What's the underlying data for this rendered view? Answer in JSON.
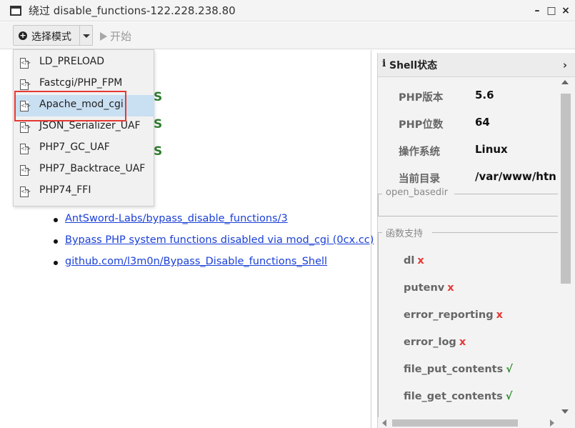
{
  "window": {
    "title": "绕过 disable_functions-122.228.238.80",
    "minimize": "–",
    "maximize": "□",
    "close": "×"
  },
  "toolbar": {
    "mode_button": "选择模式",
    "start_button": "开始"
  },
  "mode_menu": {
    "items": [
      {
        "label": "LD_PRELOAD"
      },
      {
        "label": "Fastcgi/PHP_FPM"
      },
      {
        "label": "Apache_mod_cgi"
      },
      {
        "label": "JSON_Serializer_UAF"
      },
      {
        "label": "PHP7_GC_UAF"
      },
      {
        "label": "PHP7_Backtrace_UAF"
      },
      {
        "label": "PHP74_FFI"
      }
    ],
    "selected": "Apache_mod_cgi",
    "highlight_color": "#e53935"
  },
  "main": {
    "partial_labels": [
      "S",
      "S",
      "S"
    ],
    "links": [
      "AntSword-Labs/bypass_disable_functions/3",
      "Bypass PHP system functions disabled via mod_cgi (0cx.cc)",
      "github.com/l3m0n/Bypass_Disable_functions_Shell"
    ]
  },
  "shell_status": {
    "info_icon": "i",
    "title": "Shell状态",
    "chevron": "›",
    "rows": [
      {
        "label": "PHP版本",
        "value": "5.6"
      },
      {
        "label": "PHP位数",
        "value": "64"
      },
      {
        "label": "操作系统",
        "value": "Linux"
      },
      {
        "label": "当前目录",
        "value": "/var/www/htn"
      }
    ],
    "open_basedir_label": "open_basedir",
    "functions_label": "函数支持",
    "functions": [
      {
        "name": "dl",
        "mark": "x"
      },
      {
        "name": "putenv",
        "mark": "x"
      },
      {
        "name": "error_reporting",
        "mark": "x"
      },
      {
        "name": "error_log",
        "mark": "x"
      },
      {
        "name": "file_put_contents",
        "mark": "√"
      },
      {
        "name": "file_get_contents",
        "mark": "√"
      }
    ]
  },
  "colors": {
    "accent_green": "#2e7d2e",
    "link_blue": "#1a3fd6",
    "unsupported_red": "#e53935",
    "supported_green": "#2e8b2e"
  }
}
